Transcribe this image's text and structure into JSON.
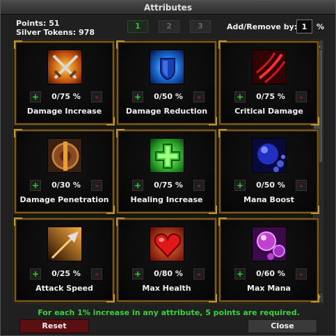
{
  "window": {
    "title": "Attributes"
  },
  "stats": {
    "points": "Points: 51",
    "silver": "Silver Tokens: 978"
  },
  "pages": [
    "1",
    "2",
    "3"
  ],
  "active_page": "1",
  "add_remove": {
    "label": "Add/Remove by:",
    "value": "1",
    "unit": "%"
  },
  "controls": {
    "plus": "+",
    "minus": "-"
  },
  "attributes": [
    {
      "name": "Damage Increase",
      "value": "0/75 %",
      "icon": "crossed-swords-icon",
      "color": "#f0a020"
    },
    {
      "name": "Damage Reduction",
      "value": "0/50 %",
      "icon": "shield-icon",
      "color": "#2a90ff"
    },
    {
      "name": "Critical Damage",
      "value": "0/75 %",
      "icon": "claw-slash-icon",
      "color": "#c01818"
    },
    {
      "name": "Damage Penetration",
      "value": "0/30 %",
      "icon": "pierced-shield-icon",
      "color": "#d07020"
    },
    {
      "name": "Healing Increase",
      "value": "0/75 %",
      "icon": "green-cross-icon",
      "color": "#3ad43a"
    },
    {
      "name": "Mana Boost",
      "value": "0/50 %",
      "icon": "mana-orb-icon",
      "color": "#2a3ad0"
    },
    {
      "name": "Attack Speed",
      "value": "0/25 %",
      "icon": "speed-arrow-icon",
      "color": "#f08020"
    },
    {
      "name": "Max Health",
      "value": "0/80 %",
      "icon": "heart-icon",
      "color": "#e01818"
    },
    {
      "name": "Max Mana",
      "value": "0/60 %",
      "icon": "mana-bubbles-icon",
      "color": "#c040d0"
    }
  ],
  "footer": {
    "note": "For each 1% increase in any attribute, 5 points are required.",
    "reset": "Reset",
    "close": "Close"
  }
}
